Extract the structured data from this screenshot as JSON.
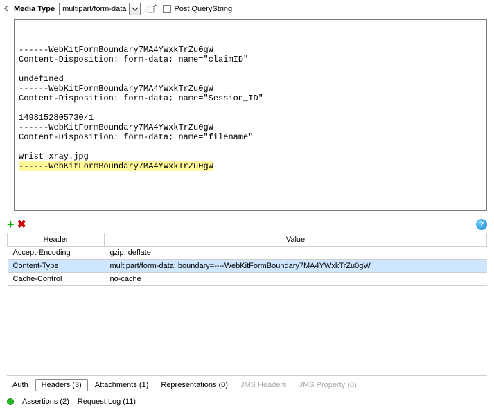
{
  "top": {
    "media_type_label": "Media Type",
    "media_type_value": "multipart/form-data",
    "post_qs_label": "Post QueryString"
  },
  "body": {
    "lines": [
      "------WebKitFormBoundary7MA4YWxkTrZu0gW",
      "Content-Disposition: form-data; name=\"claimID\"",
      "",
      "undefined",
      "------WebKitFormBoundary7MA4YWxkTrZu0gW",
      "Content-Disposition: form-data; name=\"Session_ID\"",
      "",
      "1498152805730/1",
      "------WebKitFormBoundary7MA4YWxkTrZu0gW",
      "Content-Disposition: form-data; name=\"filename\"",
      "",
      "wrist_xray.jpg"
    ],
    "highlighted_line": "------WebKitFormBoundary7MA4YWxkTrZu0gW"
  },
  "headers_table": {
    "col1": "Header",
    "col2": "Value",
    "rows": [
      {
        "h": "Accept-Encoding",
        "v": "gzip, deflate",
        "selected": false
      },
      {
        "h": "Content-Type",
        "v": "multipart/form-data; boundary=----WebKitFormBoundary7MA4YWxkTrZu0gW",
        "selected": true
      },
      {
        "h": "Cache-Control",
        "v": "no-cache",
        "selected": false
      }
    ]
  },
  "tabs": {
    "auth": "Auth",
    "headers": "Headers (3)",
    "attachments": "Attachments (1)",
    "representations": "Representations (0)",
    "jms_headers": "JMS Headers",
    "jms_property": "JMS Property (0)"
  },
  "status": {
    "assertions": "Assertions (2)",
    "request_log": "Request Log (11)"
  }
}
